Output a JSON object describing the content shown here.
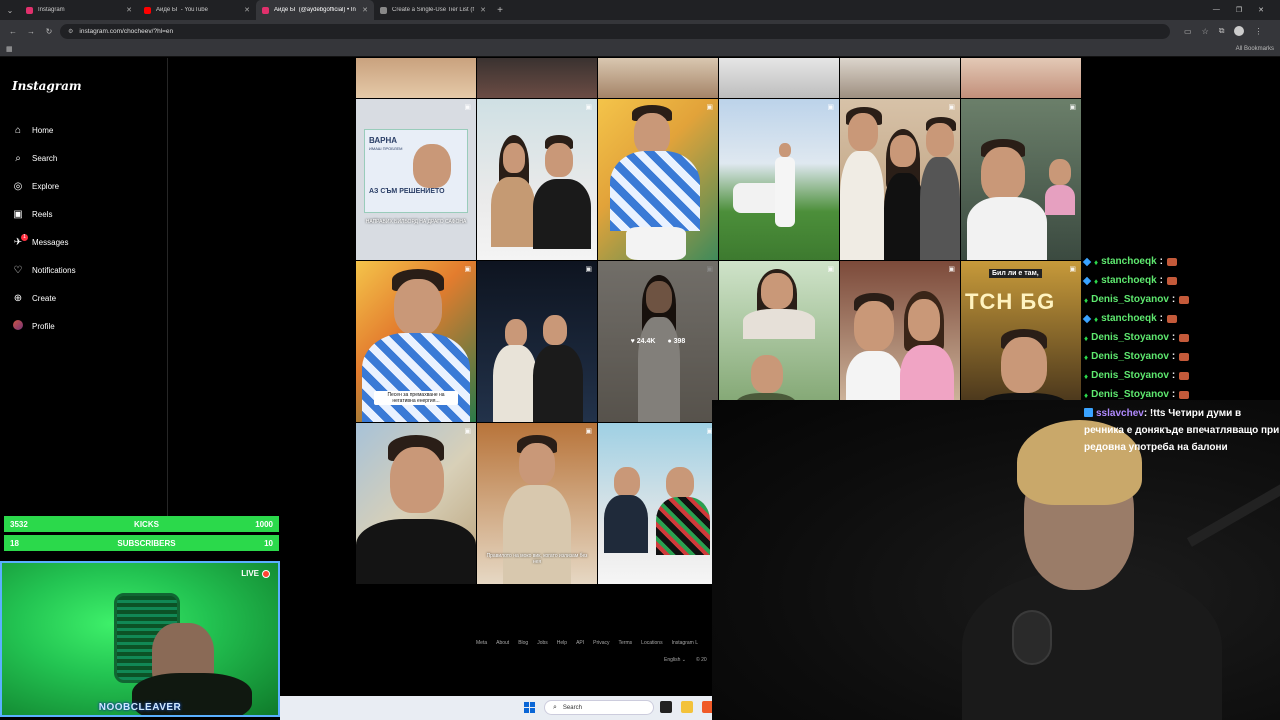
{
  "browser": {
    "tabs": [
      {
        "title": "Instagram",
        "color": "#e1306c",
        "active": false
      },
      {
        "title": "Айде БГ - YouTube",
        "color": "#ff0000",
        "active": false
      },
      {
        "title": "Айде БГ (@aydebgofficial) • In",
        "color": "#e1306c",
        "active": true
      },
      {
        "title": "Create a Single-Use Tier List (f",
        "color": "#888888",
        "active": false
      }
    ],
    "new_tab": "+",
    "url": "instagram.com/chocheev/?hl=en",
    "all_bookmarks": "All Bookmarks"
  },
  "instagram": {
    "logo": "Instagram",
    "nav": [
      {
        "label": "Home",
        "icon": "home-icon",
        "glyph": "⌂"
      },
      {
        "label": "Search",
        "icon": "search-icon",
        "glyph": "⌕"
      },
      {
        "label": "Explore",
        "icon": "explore-icon",
        "glyph": "◎"
      },
      {
        "label": "Reels",
        "icon": "reels-icon",
        "glyph": "▣"
      },
      {
        "label": "Messages",
        "icon": "messages-icon",
        "glyph": "✈"
      },
      {
        "label": "Notifications",
        "icon": "heart-icon",
        "glyph": "♡"
      },
      {
        "label": "Create",
        "icon": "create-icon",
        "glyph": "⊕"
      },
      {
        "label": "Profile",
        "icon": "profile-icon",
        "glyph": ""
      }
    ],
    "messages_badge": "1",
    "grid_captions": {
      "billboard_title": "ВАРНА",
      "billboard_sub": "ИМАШ ПРОБЛЕМ",
      "billboard_main": "АЗ СЪМ РЕШЕНИЕТО",
      "billboard_caption": "НАПРАВИХ БИЛБОРД НА ДРАГО САФОНА",
      "song_caption": "Песен за премахване на негативна енергия...",
      "rule_caption": "Правилото на моко вик, когато излизам без нея",
      "banner_text": "Бил ли е там,",
      "brand_text": "ТСН БG"
    },
    "hover_stats": {
      "likes": "24.4K",
      "comments": "398"
    },
    "footer_links": [
      "Meta",
      "About",
      "Blog",
      "Jobs",
      "Help",
      "API",
      "Privacy",
      "Terms",
      "Locations",
      "Instagram L"
    ],
    "language": "English",
    "copyright": "© 20"
  },
  "taskbar": {
    "search_placeholder": "Search"
  },
  "stream": {
    "counters": [
      {
        "left": "3532",
        "label": "KICKS",
        "right": "1000",
        "fill_fraction": 1.0
      },
      {
        "left": "18",
        "label": "SUBSCRIBERS",
        "right": "10",
        "fill_fraction": 1.0
      }
    ],
    "live_label": "LIVE",
    "streamer_name": "NOOBCLEAVER",
    "chat": [
      {
        "user": "stanchoeqk",
        "msg": ":",
        "badge": "b1"
      },
      {
        "user": "stanchoeqk",
        "msg": ":",
        "badge": "b1"
      },
      {
        "user": "Denis_Stoyanov",
        "msg": ":",
        "badge": "b2"
      },
      {
        "user": "stanchoeqk",
        "msg": ":",
        "badge": "b1"
      },
      {
        "user": "Denis_Stoyanov",
        "msg": ":",
        "badge": "b2"
      },
      {
        "user": "Denis_Stoyanov",
        "msg": ":",
        "badge": "b2"
      },
      {
        "user": "Denis_Stoyanov",
        "msg": ":",
        "badge": "b2"
      },
      {
        "user": "Denis_Stoyanov",
        "msg": ":",
        "badge": "b2"
      }
    ],
    "long_msg": {
      "user": "sslavchev",
      "text": ": !tts Четири думи в речника е донякъде впечатляващо при редовна употреба на балони"
    }
  }
}
